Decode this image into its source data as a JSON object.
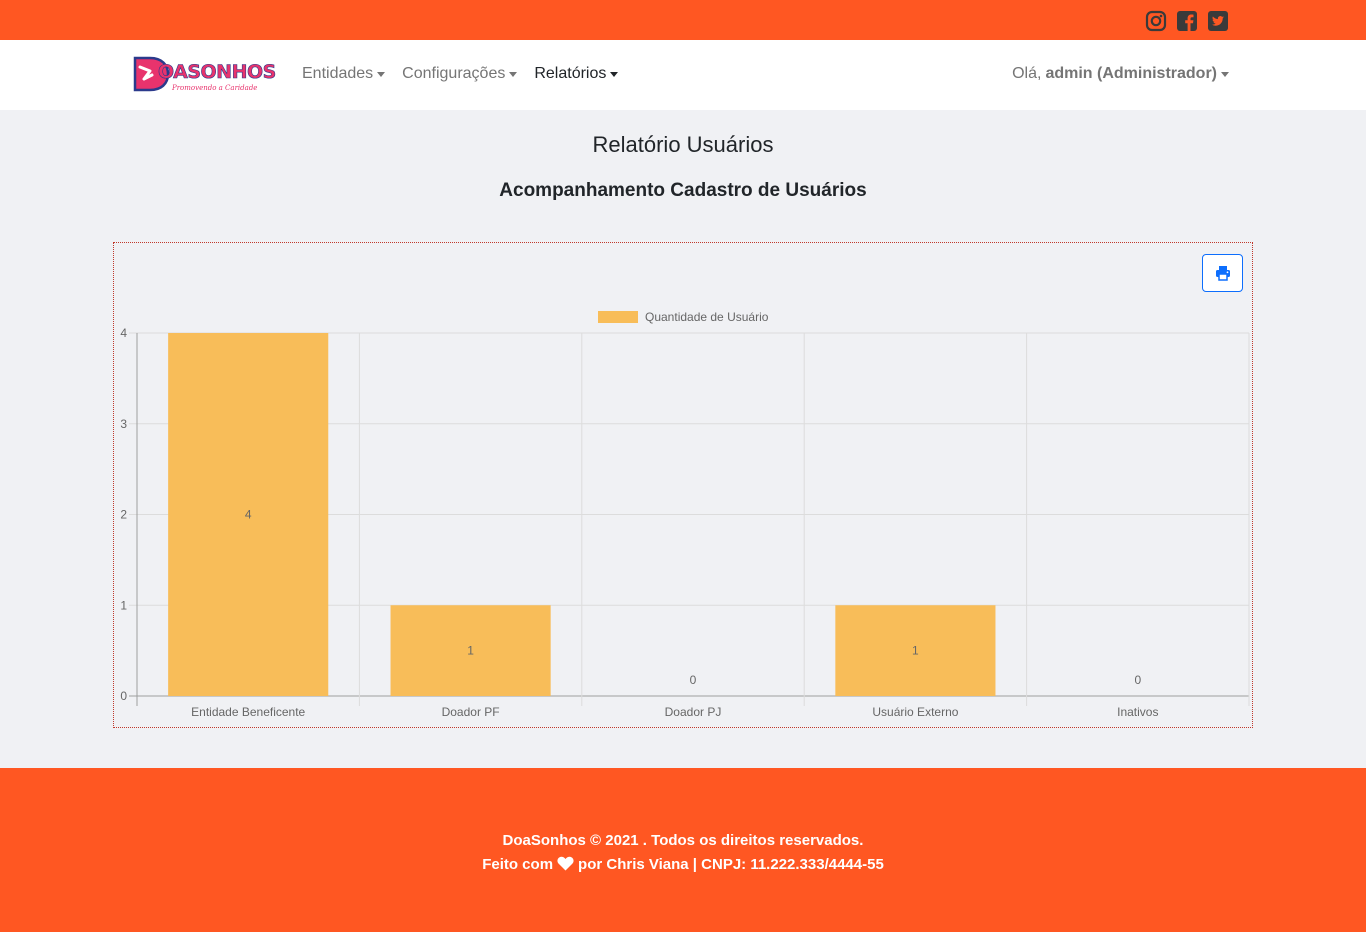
{
  "social": {
    "icons": [
      "instagram-icon",
      "facebook-icon",
      "twitter-icon"
    ],
    "color": "#3a3a3a"
  },
  "brand": {
    "name": "OASONHOS",
    "tagline": "Promovendo a Caridade",
    "color": "#e8336d"
  },
  "nav": {
    "items": [
      {
        "label": "Entidades"
      },
      {
        "label": "Configurações"
      },
      {
        "label": "Relatórios"
      }
    ],
    "greeting": "Olá,",
    "user": "admin (Administrador)"
  },
  "page": {
    "title": "Relatório Usuários",
    "subtitle": "Acompanhamento Cadastro de Usuários"
  },
  "toolbar": {
    "print_icon": "print-icon"
  },
  "chart_data": {
    "type": "bar",
    "categories": [
      "Entidade Beneficente",
      "Doador PF",
      "Doador PJ",
      "Usuário Externo",
      "Inativos"
    ],
    "series": [
      {
        "name": "Quantidade de Usuário",
        "values": [
          4,
          1,
          0,
          1,
          0
        ],
        "color": "#f8bd59"
      }
    ],
    "ylim": [
      0,
      4
    ],
    "yticks": [
      "0",
      "1",
      "2",
      "3",
      "4"
    ],
    "grid": true,
    "legend": "top-center",
    "data_labels": true
  },
  "footer": {
    "line1": "DoaSonhos © 2021 . Todos os direitos reservados.",
    "line2_prefix": "Feito com",
    "line2_suffix": "por Chris Viana | CNPJ: 11.222.333/4444-55"
  },
  "colors": {
    "accent": "#ff5722",
    "primary": "#0d6efd",
    "background": "#f0f1f4"
  }
}
